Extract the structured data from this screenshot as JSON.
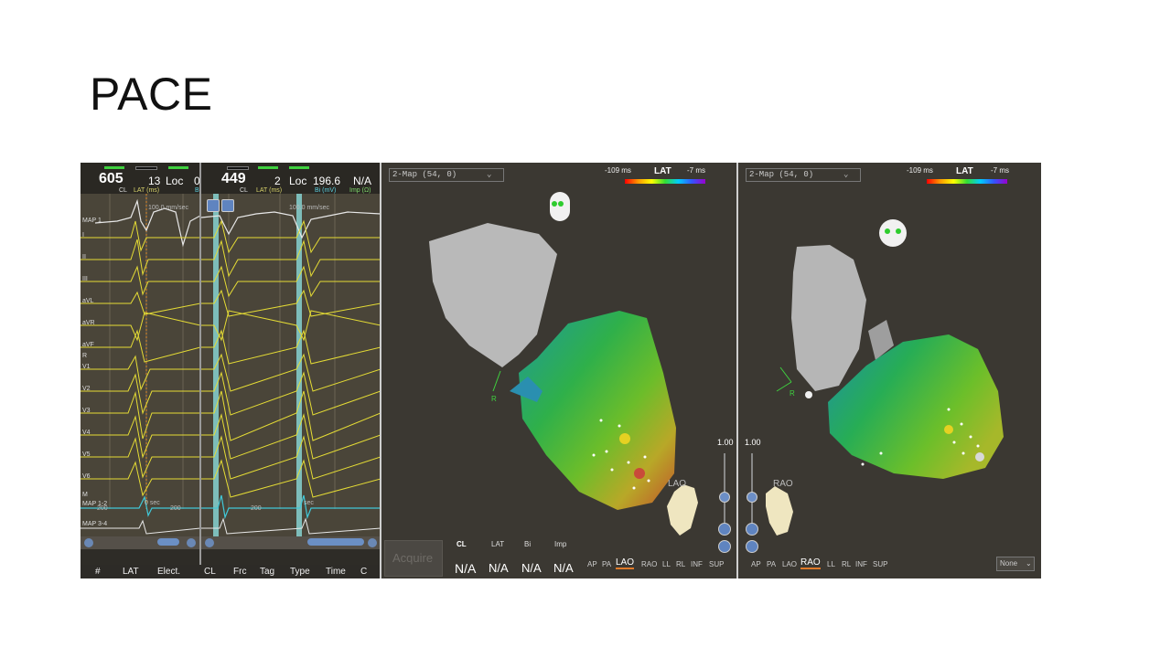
{
  "slide": {
    "title": "PACE"
  },
  "ecg_left": {
    "cycle_length": "605",
    "cl_caption": "CL",
    "lat_value": "13",
    "lat_caption": "LAT (ms)",
    "loc_label": "Loc",
    "loc_value": "0",
    "extra_caption": "Bi",
    "speed": "100.0 mm/sec",
    "time_marker": "0 sec",
    "leads": [
      "MAP 1",
      "I",
      "II",
      "III",
      "aVL",
      "aVR",
      "aVF",
      "V1",
      "V2",
      "V3",
      "V4",
      "V5",
      "V6",
      "MAP 1-2",
      "MAP 3-4"
    ],
    "marker_r": "R",
    "marker_m": "M",
    "tick_200": "200"
  },
  "ecg_right": {
    "cycle_length": "449",
    "cl_caption": "CL",
    "lat_value": "2",
    "lat_caption": "LAT (ms)",
    "loc_label": "Loc",
    "loc_value": "196.6",
    "bi_caption": "Bi (mV)",
    "na_value": "N/A",
    "imp_caption": "Imp (Ω)",
    "speed": "100.0 mm/sec",
    "time_marker": "sec",
    "tick_200": "200"
  },
  "table_header": [
    "#",
    "LAT",
    "Elect.",
    "CL",
    "Frc",
    "Tag",
    "Type",
    "Time",
    "C"
  ],
  "map_left": {
    "map_name": "2-Map (54, 0)",
    "lat_title": "LAT",
    "lat_min": "-109 ms",
    "lat_max": "-7 ms",
    "zoom_value": "1.00",
    "projection": "LAO",
    "views": [
      "AP",
      "PA",
      "LAO",
      "RAO",
      "LL",
      "RL",
      "INF",
      "SUP"
    ],
    "selected_view": "LAO",
    "axis_r": "R",
    "acquire": "Acquire",
    "readouts": [
      {
        "label": "CL",
        "value": "N/A"
      },
      {
        "label": "LAT",
        "value": "N/A"
      },
      {
        "label": "Bi",
        "value": "N/A"
      },
      {
        "label": "Imp",
        "value": "N/A"
      }
    ]
  },
  "map_right": {
    "map_name": "2-Map (54, 0)",
    "lat_title": "LAT",
    "lat_min": "-109 ms",
    "lat_max": "-7 ms",
    "zoom_value": "1.00",
    "projection": "RAO",
    "views": [
      "AP",
      "PA",
      "LAO",
      "RAO",
      "LL",
      "RL",
      "INF",
      "SUP"
    ],
    "selected_view": "RAO",
    "axis_r": "R",
    "display_select": "None"
  }
}
